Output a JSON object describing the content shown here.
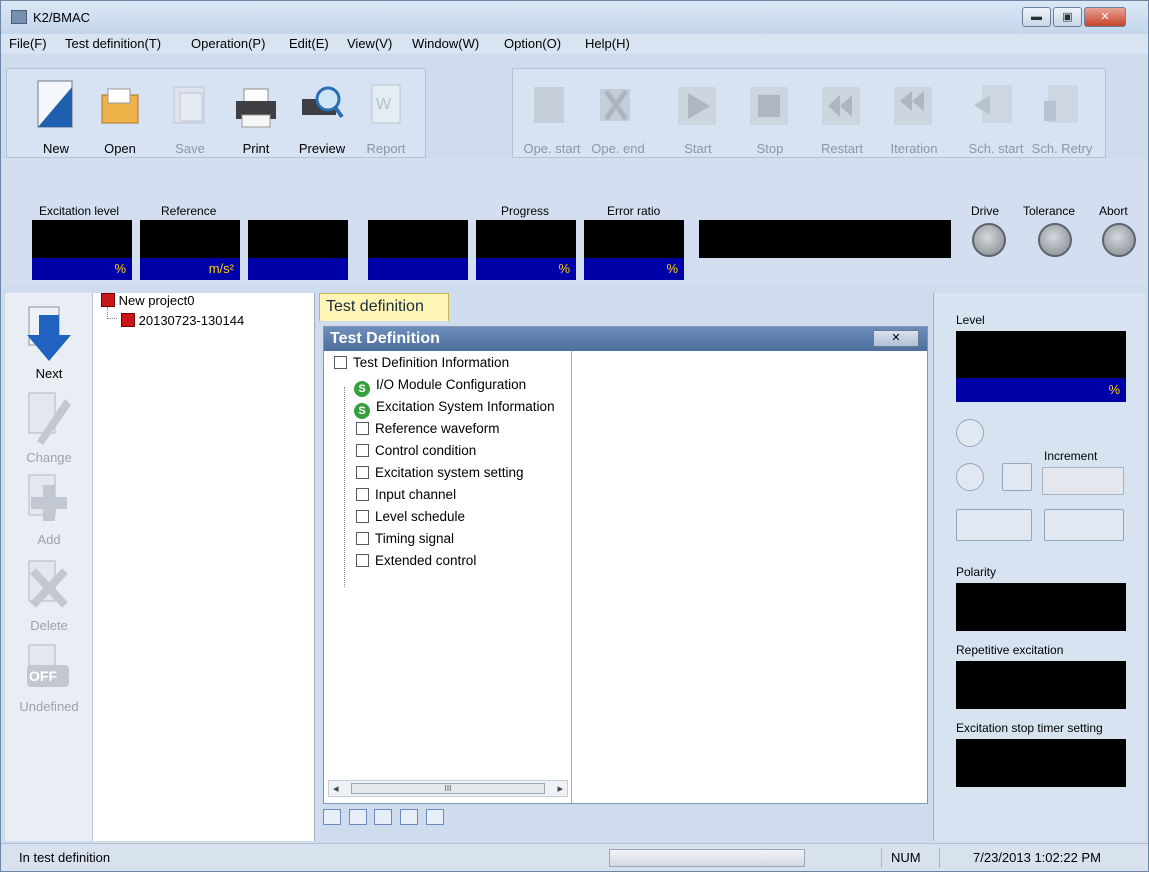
{
  "window": {
    "title": "K2/BMAC",
    "minimize_label": "▬",
    "maximize_label": "▣",
    "close_label": "✕"
  },
  "menu": [
    "File(F)",
    "Test definition(T)",
    "Operation(P)",
    "Edit(E)",
    "View(V)",
    "Window(W)",
    "Option(O)",
    "Help(H)"
  ],
  "toolbar": {
    "new": "New",
    "open": "Open",
    "save": "Save",
    "print": "Print",
    "preview": "Preview",
    "report": "Report",
    "ope_start": "Ope. start",
    "ope_end": "Ope. end",
    "start": "Start",
    "stop": "Stop",
    "restart": "Restart",
    "iteration": "Iteration",
    "sch_start": "Sch. start",
    "sch_retry": "Sch. Retry"
  },
  "meters": {
    "excitation_level": "Excitation level",
    "reference": "Reference",
    "progress": "Progress",
    "error_ratio": "Error ratio",
    "unit_percent": "%",
    "unit_accel": "m/s²",
    "drive": "Drive",
    "tolerance": "Tolerance",
    "abort": "Abort"
  },
  "side": {
    "next": "Next",
    "change": "Change",
    "add": "Add",
    "delete": "Delete",
    "undefined": "Undefined",
    "off_badge": "OFF"
  },
  "project": {
    "name": "New project0",
    "item": "20130723-130144"
  },
  "test_definition": {
    "tab_label": "Test definition",
    "window_title": "Test Definition",
    "close_label": "✕",
    "root": "Test Definition Information",
    "status_icon_letter": "S",
    "nodes": [
      "I/O Module Configuration",
      "Excitation System Information",
      "Reference waveform",
      "Control condition",
      "Excitation system setting",
      "Input channel",
      "Level schedule",
      "Timing signal",
      "Extended control"
    ],
    "scroll_left": "◂",
    "scroll_right": "▸",
    "scroll_thumb": "III"
  },
  "right_panel": {
    "level": "Level",
    "unit": "%",
    "increment": "Increment",
    "polarity": "Polarity",
    "repetitive": "Repetitive excitation",
    "stop_timer": "Excitation stop timer setting"
  },
  "status": {
    "text": "In test definition",
    "num": "NUM",
    "datetime": "7/23/2013  1:02:22 PM"
  }
}
